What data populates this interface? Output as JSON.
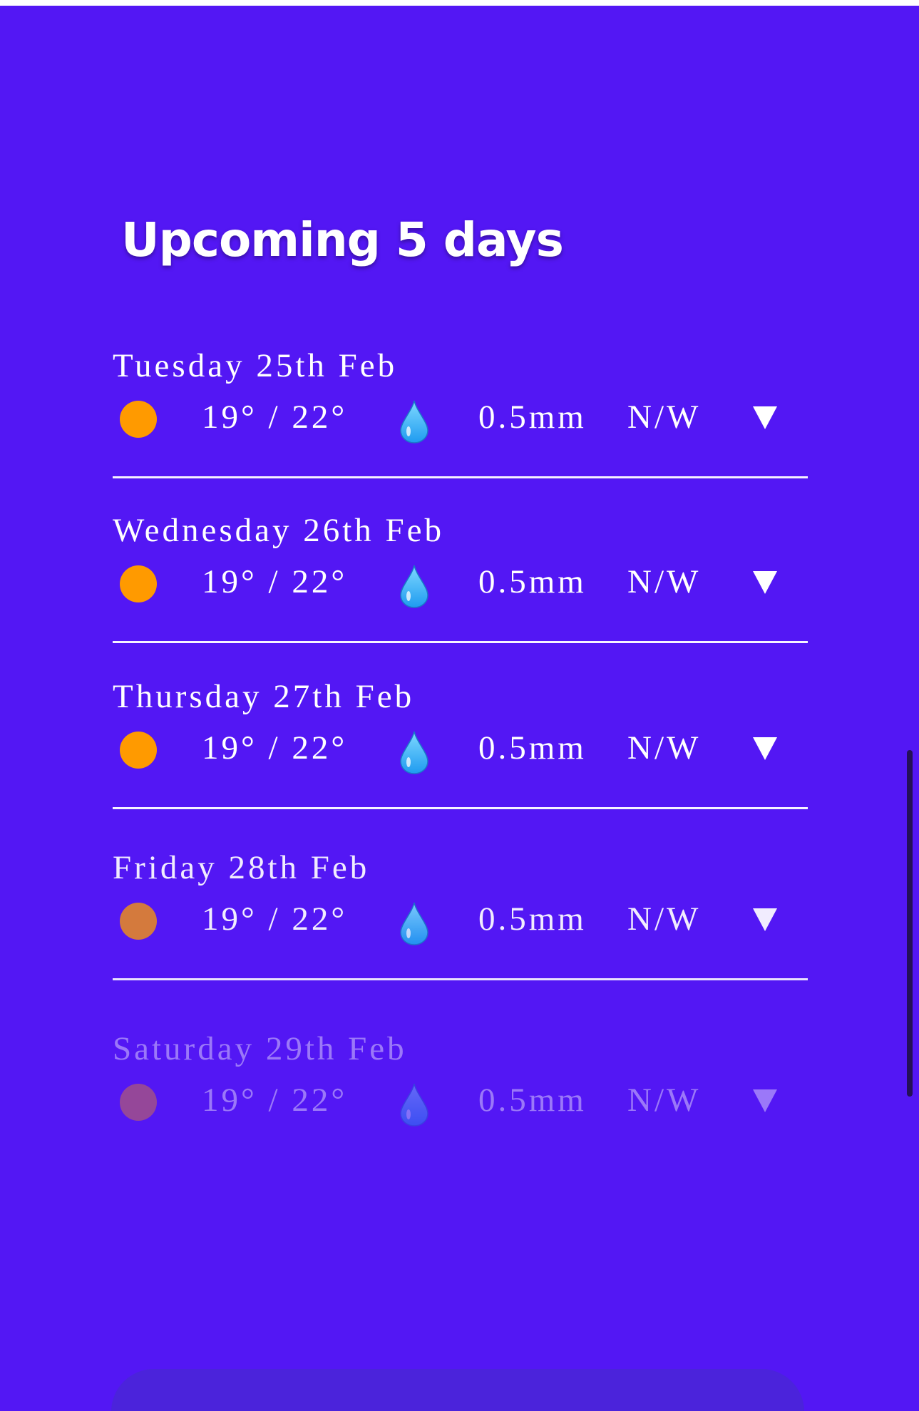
{
  "title": "Upcoming 5 days",
  "colors": {
    "background": "#5317f4",
    "text": "#ffffff",
    "sun": "#ff9a00",
    "drop": "#2fb6ff"
  },
  "days": [
    {
      "name": "Tuesday 25th Feb",
      "weather_icon": "sun-icon",
      "temps": "19° / 22°",
      "rain_icon": "droplet-icon",
      "rain": "0.5mm",
      "wind": "N/W"
    },
    {
      "name": "Wednesday 26th Feb",
      "weather_icon": "sun-icon",
      "temps": "19° / 22°",
      "rain_icon": "droplet-icon",
      "rain": "0.5mm",
      "wind": "N/W"
    },
    {
      "name": "Thursday 27th Feb",
      "weather_icon": "sun-icon",
      "temps": "19° / 22°",
      "rain_icon": "droplet-icon",
      "rain": "0.5mm",
      "wind": "N/W"
    },
    {
      "name": "Friday 28th Feb",
      "weather_icon": "sun-icon",
      "temps": "19° / 22°",
      "rain_icon": "droplet-icon",
      "rain": "0.5mm",
      "wind": "N/W"
    },
    {
      "name": "Saturday 29th Feb",
      "weather_icon": "sun-icon",
      "temps": "19° / 22°",
      "rain_icon": "droplet-icon",
      "rain": "0.5mm",
      "wind": "N/W"
    }
  ]
}
